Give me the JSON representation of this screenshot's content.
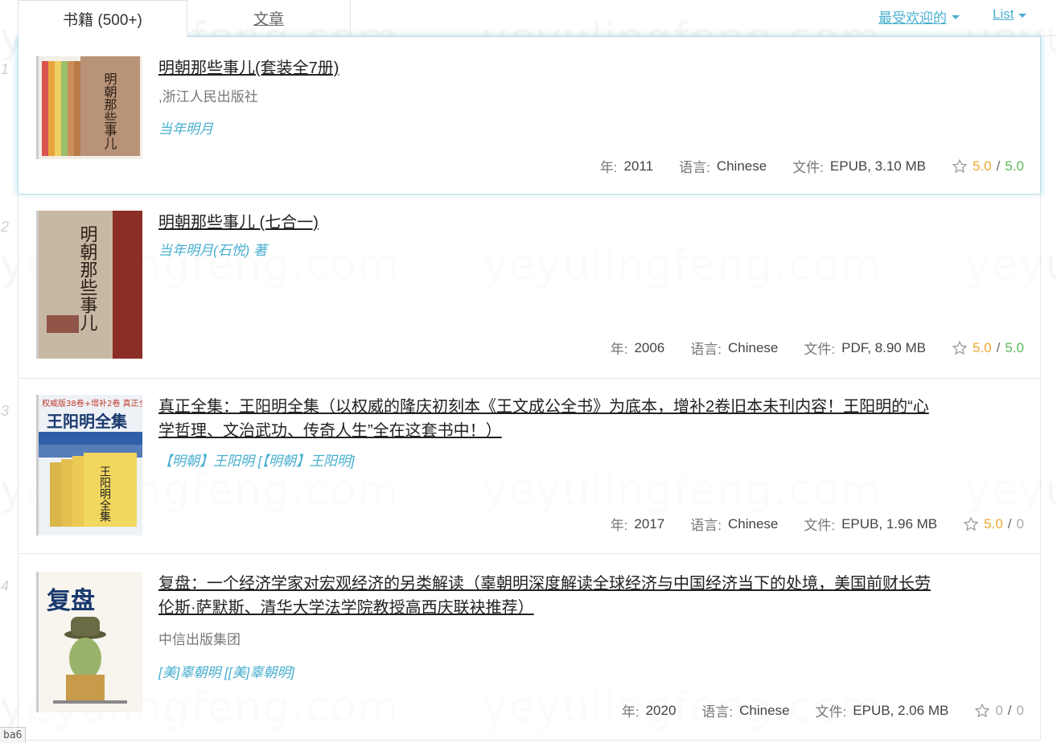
{
  "tabs": {
    "books": "书籍 (500+)",
    "articles": "文章"
  },
  "sort": {
    "label": "最受欢迎的"
  },
  "view": {
    "label": "List"
  },
  "watermark": "yeyulingfeng.com",
  "labels": {
    "year": "年:",
    "language": "语言:",
    "file": "文件:",
    "rating_sep": "/"
  },
  "books": [
    {
      "index": "1",
      "title": "明朝那些事儿(套装全7册)",
      "publisher": ",浙江人民出版社",
      "author": "当年明月",
      "year": "2011",
      "language": "Chinese",
      "file": "EPUB, 3.10 MB",
      "rating_a": "5.0",
      "rating_b": "5.0"
    },
    {
      "index": "2",
      "title": "明朝那些事儿 (七合一)",
      "publisher": "",
      "author": "当年明月(石悦) 著",
      "year": "2006",
      "language": "Chinese",
      "file": "PDF, 8.90 MB",
      "rating_a": "5.0",
      "rating_b": "5.0"
    },
    {
      "index": "3",
      "title": "真正全集：王阳明全集（以权威的隆庆初刻本《王文成公全书》为底本，增补2卷旧本未刊内容！王阳明的“心学哲理、文治武功、传奇人生”全在这套书中！）",
      "publisher": "",
      "author": "【明朝】王阳明 [【明朝】王阳明]",
      "year": "2017",
      "language": "Chinese",
      "file": "EPUB, 1.96 MB",
      "rating_a": "5.0",
      "rating_b": "0"
    },
    {
      "index": "4",
      "title": "复盘：一个经济学家对宏观经济的另类解读（辜朝明深度解读全球经济与中国经济当下的处境，美国前财长劳伦斯·萨默斯、清华大学法学院教授高西庆联袂推荐）",
      "publisher": "中信出版集团",
      "author": "[美]辜朝明 [[美]辜朝明]",
      "year": "2020",
      "language": "Chinese",
      "file": "EPUB, 2.06 MB",
      "rating_a": "0",
      "rating_b": "0"
    }
  ],
  "covers": {
    "c1_text": "明朝那些事儿",
    "c2_text": "明朝那些事儿",
    "c3_top": "权威版38卷+增补2卷 真正全集",
    "c3_title": "王阳明全集",
    "c3_inner": "王阳明全集",
    "c4_title": "复盘"
  },
  "status_text": "ba6",
  "colors": {
    "accent": "#49afd0",
    "rating_a": "#f0a830",
    "rating_b": "#5cb85c"
  }
}
